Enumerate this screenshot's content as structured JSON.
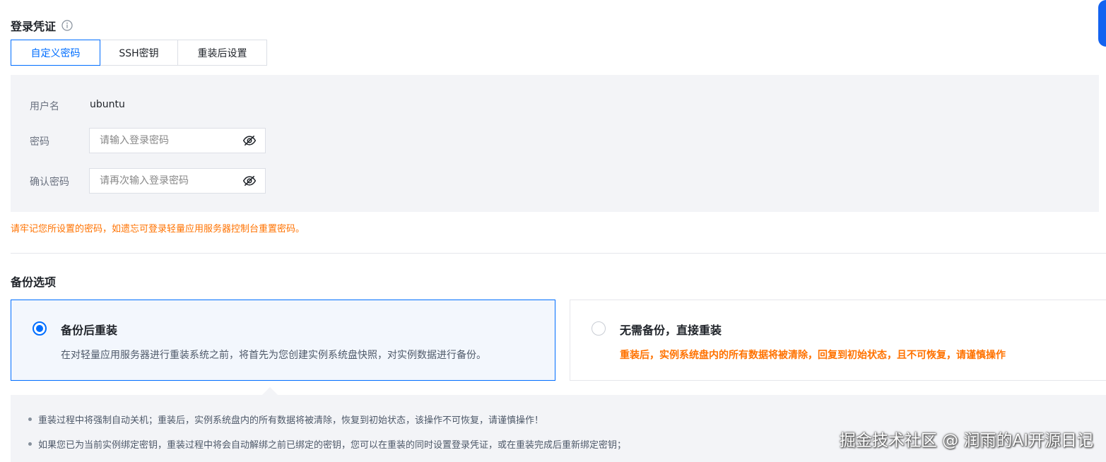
{
  "credentials": {
    "title": "登录凭证",
    "tabs": [
      {
        "label": "自定义密码",
        "active": true
      },
      {
        "label": "SSH密钥",
        "active": false
      },
      {
        "label": "重装后设置",
        "active": false
      }
    ],
    "username_label": "用户名",
    "username_value": "ubuntu",
    "password_label": "密码",
    "password_placeholder": "请输入登录密码",
    "confirm_label": "确认密码",
    "confirm_placeholder": "请再次输入登录密码",
    "warning": "请牢记您所设置的密码，如遗忘可登录轻量应用服务器控制台重置密码。"
  },
  "backup": {
    "title": "备份选项",
    "options": [
      {
        "title": "备份后重装",
        "desc": "在对轻量应用服务器进行重装系统之前，将首先为您创建实例系统盘快照，对实例数据进行备份。",
        "selected": true
      },
      {
        "title": "无需备份，直接重装",
        "desc": "重装后，实例系统盘内的所有数据将被清除，回复到初始状态，且不可恢复，请谨慎操作",
        "selected": false
      }
    ],
    "notes": [
      "重装过程中将强制自动关机；重装后，实例系统盘内的所有数据将被清除，恢复到初始状态，该操作不可恢复，请谨慎操作！",
      "如果您已为当前实例绑定密钥，重装过程中将会自动解绑之前已绑定的密钥，您可以在重装的同时设置登录凭证，或在重装完成后重新绑定密钥；"
    ]
  },
  "watermark": "掘金技术社区 @ 润雨的AI开源日记",
  "colors": {
    "accent": "#006eff",
    "warning": "#ff7200",
    "panel_bg": "#f3f4f7"
  },
  "icons": {
    "info": "info-icon",
    "eye_off": "eye-off-icon"
  }
}
